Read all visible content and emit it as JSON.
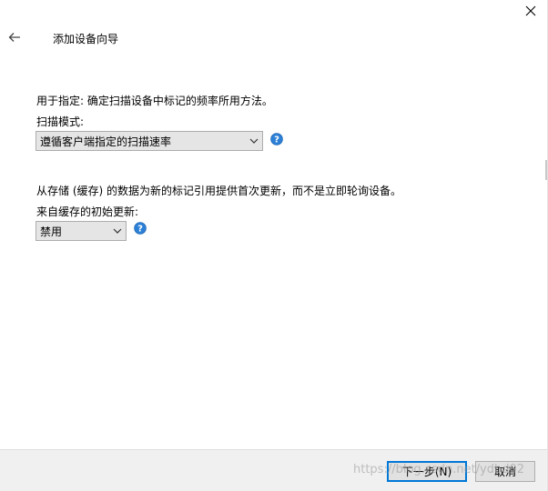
{
  "window": {
    "title": "添加设备向导",
    "icons": {
      "close": "close-icon",
      "back": "back-arrow-icon",
      "help": "help-question-icon"
    }
  },
  "scan": {
    "description": "用于指定: 确定扫描设备中标记的频率所用方法。",
    "mode_label": "扫描模式:",
    "mode_value": "遵循客户端指定的扫描速率"
  },
  "cache": {
    "description": "从存储 (缓存) 的数据为新的标记引用提供首次更新，而不是立即轮询设备。",
    "initial_label": "来自缓存的初始更新:",
    "initial_value": "禁用"
  },
  "footer": {
    "next_label": "下一步(N)",
    "cancel_label": "取消",
    "watermark": "https://blog.csdn.net/ydbd02"
  },
  "colors": {
    "accent": "#0078d7",
    "help_icon": "#2b7fd6",
    "footer_bg": "#f0f0f0",
    "combo_bg": "#e5e5e5"
  }
}
